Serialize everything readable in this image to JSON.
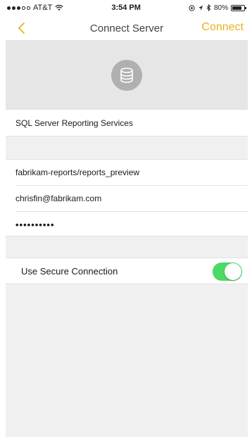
{
  "status_bar": {
    "carrier": "AT&T",
    "time": "3:54 PM",
    "battery_percent": "80%",
    "battery_level": 0.8,
    "icons": [
      "signal-icon",
      "wifi-icon",
      "location-icon",
      "bluetooth-icon",
      "battery-icon"
    ]
  },
  "nav": {
    "title": "Connect Server",
    "connect_label": "Connect",
    "accent_color": "#e8b21c"
  },
  "hero": {
    "icon": "database-icon"
  },
  "server_type": {
    "label": "SQL Server Reporting Services"
  },
  "fields": {
    "server_address": "fabrikam-reports/reports_preview",
    "username": "chrisfin@fabrikam.com",
    "password_masked": "••••••••••"
  },
  "secure_connection": {
    "label": "Use Secure Connection",
    "enabled": true,
    "toggle_color": "#4cd964"
  }
}
